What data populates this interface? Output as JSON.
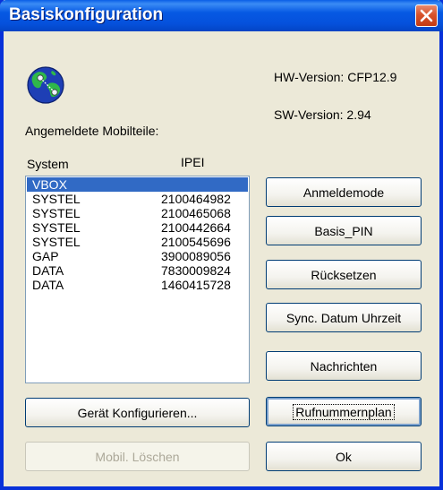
{
  "window": {
    "title": "Basiskonfiguration"
  },
  "info": {
    "hw_version": "HW-Version: CFP12.9",
    "sw_version": "SW-Version: 2.94",
    "registered_label": "Angemeldete Mobilteile:"
  },
  "list": {
    "headers": [
      "System",
      "IPEI"
    ],
    "rows": [
      [
        "VBOX",
        ""
      ],
      [
        "SYSTEL",
        "2100464982"
      ],
      [
        "SYSTEL",
        "2100465068"
      ],
      [
        "SYSTEL",
        "2100442664"
      ],
      [
        "SYSTEL",
        "2100545696"
      ],
      [
        "GAP",
        "3900089056"
      ],
      [
        "DATA",
        "7830009824"
      ],
      [
        "DATA",
        "1460415728"
      ]
    ],
    "selected_index": 0
  },
  "buttons": {
    "anmeldemode": "Anmeldemode",
    "basis_pin": "Basis_PIN",
    "ruecksetzen": "Rücksetzen",
    "sync": "Sync. Datum Uhrzeit",
    "nachrichten": "Nachrichten",
    "rufnummernplan": "Rufnummernplan",
    "geraet_konfigurieren": "Gerät Konfigurieren...",
    "mobil_loeschen": "Mobil. Löschen",
    "ok": "Ok"
  },
  "icons": {
    "app": "globe-icon",
    "close": "close-icon"
  },
  "colors": {
    "titlebar": "#0551dc",
    "selection": "#316ac5",
    "close": "#d8532b"
  }
}
